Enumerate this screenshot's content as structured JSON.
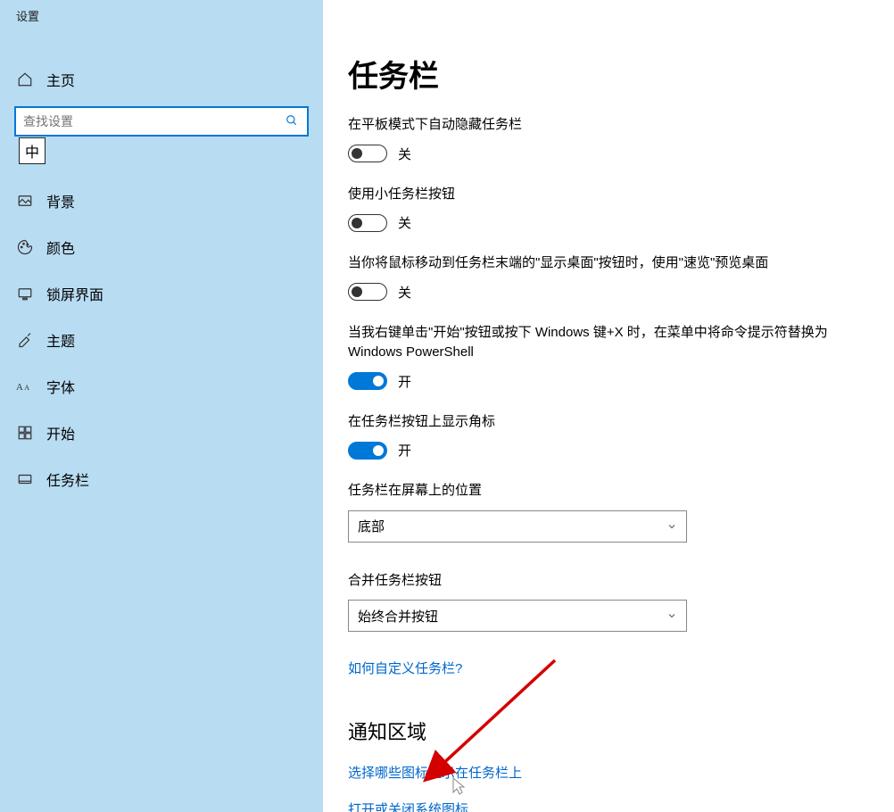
{
  "sidebar": {
    "app_title": "设置",
    "home_label": "主页",
    "search_placeholder": "查找设置",
    "ime_badge": "中",
    "items": [
      {
        "label": "背景",
        "icon": "background-icon"
      },
      {
        "label": "颜色",
        "icon": "colors-icon"
      },
      {
        "label": "锁屏界面",
        "icon": "lockscreen-icon"
      },
      {
        "label": "主题",
        "icon": "themes-icon"
      },
      {
        "label": "字体",
        "icon": "fonts-icon"
      },
      {
        "label": "开始",
        "icon": "start-icon"
      },
      {
        "label": "任务栏",
        "icon": "taskbar-icon"
      }
    ]
  },
  "main": {
    "title": "任务栏",
    "settings": [
      {
        "label": "在平板模式下自动隐藏任务栏",
        "state": "关",
        "on": false
      },
      {
        "label": "使用小任务栏按钮",
        "state": "关",
        "on": false
      },
      {
        "label": "当你将鼠标移动到任务栏末端的\"显示桌面\"按钮时，使用\"速览\"预览桌面",
        "state": "关",
        "on": false
      },
      {
        "label": "当我右键单击\"开始\"按钮或按下 Windows 键+X 时，在菜单中将命令提示符替换为 Windows PowerShell",
        "state": "开",
        "on": true
      },
      {
        "label": "在任务栏按钮上显示角标",
        "state": "开",
        "on": true
      }
    ],
    "position_label": "任务栏在屏幕上的位置",
    "position_value": "底部",
    "combine_label": "合并任务栏按钮",
    "combine_value": "始终合并按钮",
    "help_link": "如何自定义任务栏?",
    "notification_heading": "通知区域",
    "links": [
      "选择哪些图标显示在任务栏上",
      "打开或关闭系统图标"
    ]
  }
}
